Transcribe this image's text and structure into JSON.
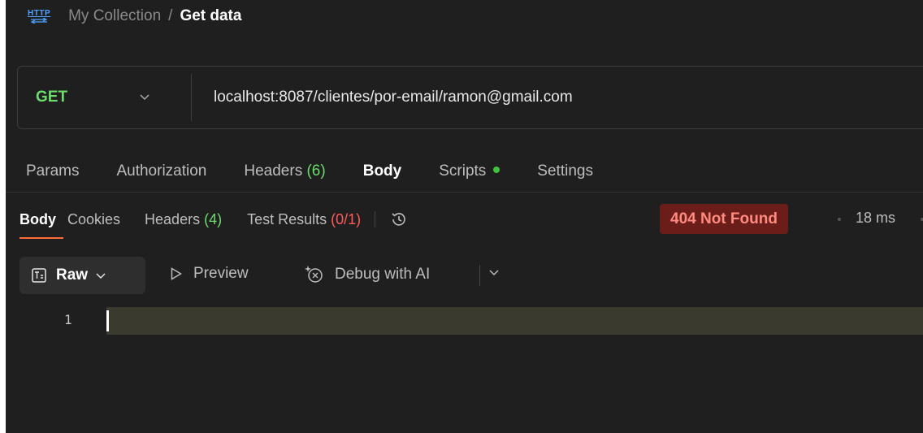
{
  "breadcrumb": {
    "icon_text": "HTTP",
    "parent": "My Collection",
    "separator": "/",
    "current": "Get data"
  },
  "request": {
    "method": "GET",
    "url": "localhost:8087/clientes/por-email/ramon@gmail.com"
  },
  "request_tabs": [
    {
      "label": "Params"
    },
    {
      "label": "Authorization"
    },
    {
      "label": "Headers",
      "count": "(6)"
    },
    {
      "label": "Body",
      "active": true
    },
    {
      "label": "Scripts",
      "indicator": "green-dot"
    },
    {
      "label": "Settings"
    }
  ],
  "response_tabs": [
    {
      "label": "Body",
      "active": true
    },
    {
      "label": "Cookies"
    },
    {
      "label": "Headers",
      "count": "(4)"
    },
    {
      "label": "Test Results",
      "count": "(0/1)"
    }
  ],
  "response": {
    "status": "404 Not Found",
    "time": "18 ms"
  },
  "toolbar": {
    "format": "Raw",
    "preview": "Preview",
    "debug": "Debug with AI"
  },
  "editor": {
    "line_number": "1"
  },
  "colors": {
    "background": "#1f1f1f",
    "method_get": "#6bdd6b",
    "status_error_bg": "#6b1d1a",
    "status_error_text": "#ff8a80",
    "active_tab_underline": "#ff6c37"
  }
}
